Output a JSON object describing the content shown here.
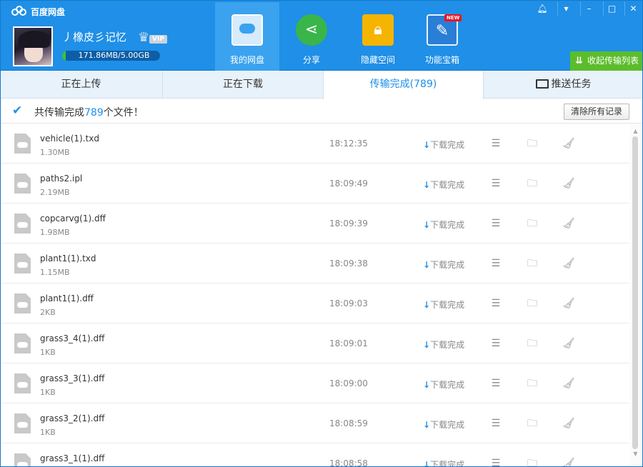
{
  "app": {
    "title": "百度网盘"
  },
  "user": {
    "name": "丿橡皮彡记忆",
    "vip_label": "VIP",
    "quota_text": "171.86MB/5.00GB",
    "quota_fraction": 0.034
  },
  "nav": [
    {
      "label": "我的网盘",
      "icon": "cloud-disk-icon"
    },
    {
      "label": "分享",
      "icon": "share-icon"
    },
    {
      "label": "隐藏空间",
      "icon": "lock-icon"
    },
    {
      "label": "功能宝箱",
      "icon": "toolbox-icon",
      "badge": "NEW"
    }
  ],
  "window_controls": [
    "notification-icon",
    "menu-icon",
    "minimize-icon",
    "maximize-icon",
    "close-icon"
  ],
  "collapse_button": {
    "label": "收起传输列表"
  },
  "tabs": [
    {
      "label": "正在上传"
    },
    {
      "label": "正在下载"
    },
    {
      "label": "传输完成(789)"
    },
    {
      "label": "推送任务"
    }
  ],
  "summary": {
    "prefix": "共传输完成",
    "count": "789",
    "suffix": "个文件！",
    "clear_label": "清除所有记录"
  },
  "status_label": "下载完成",
  "files": [
    {
      "name": "vehicle(1).txd",
      "size": "1.30MB",
      "time": "18:12:35"
    },
    {
      "name": "paths2.ipl",
      "size": "2.19MB",
      "time": "18:09:49"
    },
    {
      "name": "copcarvg(1).dff",
      "size": "1.98MB",
      "time": "18:09:39"
    },
    {
      "name": "plant1(1).txd",
      "size": "1.15MB",
      "time": "18:09:38"
    },
    {
      "name": "plant1(1).dff",
      "size": "2KB",
      "time": "18:09:03"
    },
    {
      "name": "grass3_4(1).dff",
      "size": "1KB",
      "time": "18:09:01"
    },
    {
      "name": "grass3_3(1).dff",
      "size": "1KB",
      "time": "18:09:00"
    },
    {
      "name": "grass3_2(1).dff",
      "size": "1KB",
      "time": "18:08:59"
    },
    {
      "name": "grass3_1(1).dff",
      "size": "",
      "time": "18:08:58"
    }
  ],
  "colors": {
    "brand_blue": "#1f8fe7",
    "green_button": "#5bbd2c"
  }
}
